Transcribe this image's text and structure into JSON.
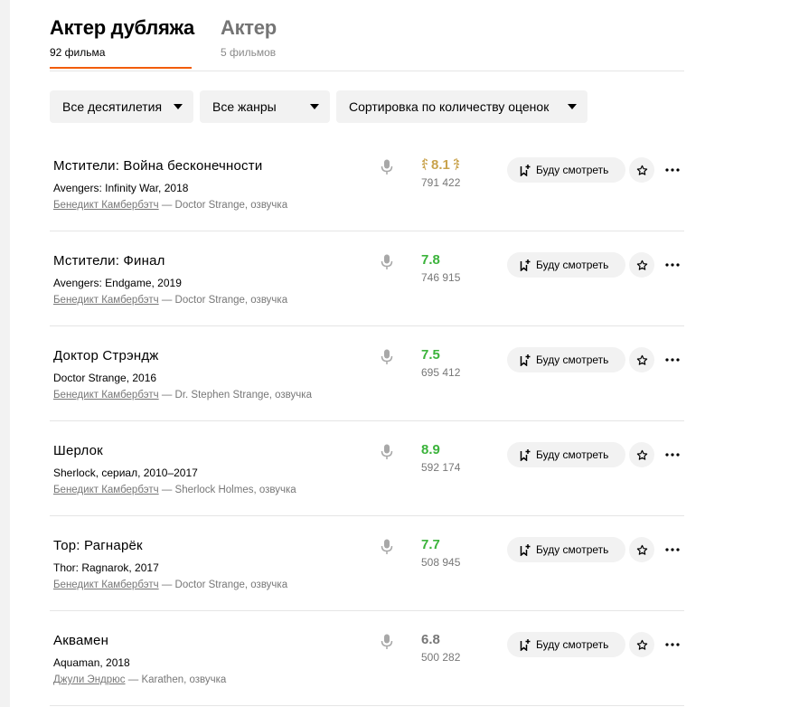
{
  "tabs": [
    {
      "title": "Актер дубляжа",
      "subtitle": "92 фильма",
      "active": true
    },
    {
      "title": "Актер",
      "subtitle": "5 фильмов",
      "active": false
    }
  ],
  "filters": {
    "decades": "Все десятилетия",
    "genres": "Все жанры",
    "sort": "Сортировка по количеству оценок"
  },
  "watch_label": "Буду смотреть",
  "role_separator": " — ",
  "colors": {
    "accent": "#f25c05",
    "rating_green": "#3bb33b",
    "rating_gold": "#c9a34d",
    "rating_gray": "#777777"
  },
  "icons": {
    "mic": "microphone-icon",
    "watchlist": "bookmark-plus-icon",
    "favorite": "star-icon",
    "more": "more-dots-icon",
    "top": "laurel-wreath-icon"
  },
  "films": [
    {
      "title": "Мстители: Война бесконечности",
      "original": "Avengers: Infinity War, 2018",
      "person": "Бенедикт Камбербэтч",
      "role": "Doctor Strange, озвучка",
      "rating": "8.1",
      "votes": "791 422",
      "rating_style": "gold"
    },
    {
      "title": "Мстители: Финал",
      "original": "Avengers: Endgame, 2019",
      "person": "Бенедикт Камбербэтч",
      "role": "Doctor Strange, озвучка",
      "rating": "7.8",
      "votes": "746 915",
      "rating_style": "green"
    },
    {
      "title": "Доктор Стрэндж",
      "original": "Doctor Strange, 2016",
      "person": "Бенедикт Камбербэтч",
      "role": "Dr. Stephen Strange, озвучка",
      "rating": "7.5",
      "votes": "695 412",
      "rating_style": "green"
    },
    {
      "title": "Шерлок",
      "original": "Sherlock, сериал, 2010–2017",
      "person": "Бенедикт Камбербэтч",
      "role": "Sherlock Holmes, озвучка",
      "rating": "8.9",
      "votes": "592 174",
      "rating_style": "green"
    },
    {
      "title": "Тор: Рагнарёк",
      "original": "Thor: Ragnarok, 2017",
      "person": "Бенедикт Камбербэтч",
      "role": "Doctor Strange, озвучка",
      "rating": "7.7",
      "votes": "508 945",
      "rating_style": "green"
    },
    {
      "title": "Аквамен",
      "original": "Aquaman, 2018",
      "person": "Джули Эндрюс",
      "role": "Karathen, озвучка",
      "rating": "6.8",
      "votes": "500 282",
      "rating_style": "gray"
    }
  ]
}
